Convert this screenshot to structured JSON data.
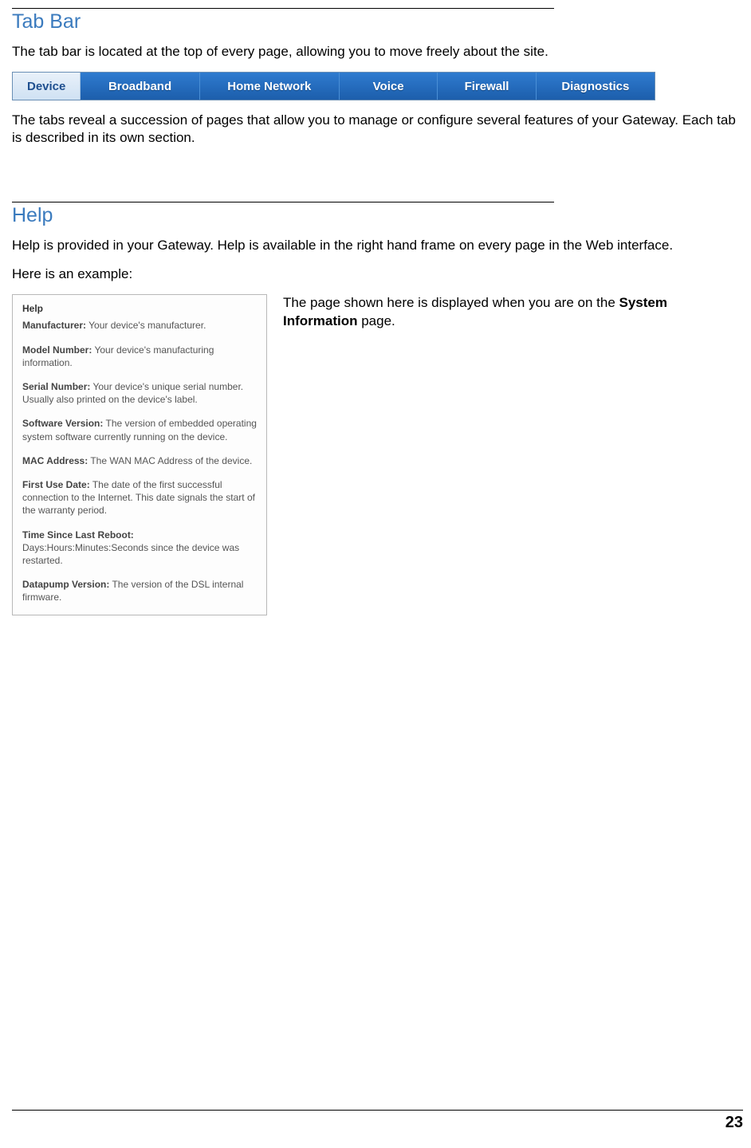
{
  "section1": {
    "heading": "Tab Bar",
    "intro": "The tab bar is located at the top of every page, allowing you to move freely about the site.",
    "tabs": [
      "Device",
      "Broadband",
      "Home Network",
      "Voice",
      "Firewall",
      "Diagnostics"
    ],
    "after": "The tabs reveal a succession of pages that allow you to manage or configure several features of your Gateway. Each tab is described in its own section."
  },
  "section2": {
    "heading": "Help",
    "intro": "Help is provided in your Gateway. Help is available in the right hand frame on every page in the Web interface.",
    "example_label": "Here is an example:",
    "panel_title": "Help",
    "panel_items": [
      {
        "term": "Manufacturer:",
        "desc": " Your device's manufacturer."
      },
      {
        "term": "Model Number:",
        "desc": " Your device's manufacturing information."
      },
      {
        "term": "Serial Number:",
        "desc": " Your device's unique serial number. Usually also printed on the device's label."
      },
      {
        "term": "Software Version:",
        "desc": " The version of embedded operating system software currently running on the device."
      },
      {
        "term": "MAC Address:",
        "desc": " The WAN MAC Address of the device."
      },
      {
        "term": "First Use Date:",
        "desc": " The date of the first successful connection to the Internet. This date signals the start of the warranty period."
      },
      {
        "term": "Time Since Last Reboot:",
        "desc": "\nDays:Hours:Minutes:Seconds since the device was restarted."
      },
      {
        "term": "Datapump Version:",
        "desc": " The version of the DSL internal firmware."
      }
    ],
    "right_pre": "The page shown here is displayed when you are on the ",
    "right_bold": "System Information",
    "right_post": " page."
  },
  "page_number": "23"
}
